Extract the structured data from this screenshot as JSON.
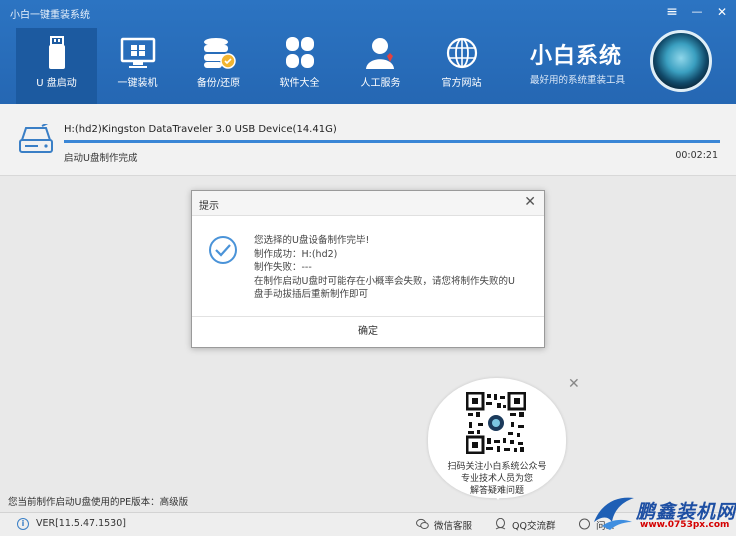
{
  "app": {
    "title": "小白一键重装系统"
  },
  "window_controls": {
    "menu": "≡",
    "minimize": "—",
    "close": "✕"
  },
  "nav": {
    "items": [
      {
        "label": "U 盘启动",
        "icon": "usb-drive-icon",
        "active": true
      },
      {
        "label": "一键装机",
        "icon": "monitor-icon",
        "active": false
      },
      {
        "label": "备份/还原",
        "icon": "database-backup-icon",
        "active": false
      },
      {
        "label": "软件大全",
        "icon": "clover-apps-icon",
        "active": false
      },
      {
        "label": "人工服务",
        "icon": "support-person-icon",
        "active": false
      },
      {
        "label": "官方网站",
        "icon": "globe-icon",
        "active": false
      }
    ]
  },
  "brand": {
    "name": "小白系统",
    "slogan": "最好用的系统重装工具"
  },
  "device": {
    "name": "H:(hd2)Kingston DataTraveler 3.0 USB Device(14.41G)",
    "status": "启动U盘制作完成",
    "elapsed": "00:02:21",
    "progress": 1.0
  },
  "dialog": {
    "title": "提示",
    "close": "✕",
    "lines": [
      "您选择的U盘设备制作完毕!",
      "制作成功：H:(hd2)",
      "制作失败：---",
      "在制作启动U盘时可能存在小概率会失败，请您将制作失败的U",
      "盘手动拔插后重新制作即可"
    ],
    "ok": "确定"
  },
  "qr_popup": {
    "close": "✕",
    "lines": [
      "扫码关注小白系统公众号",
      "专业技术人员为您",
      "解答疑难问题"
    ]
  },
  "footer": {
    "pe_info": "您当前制作启动U盘使用的PE版本：高级版",
    "version": "VER[11.5.47.1530]",
    "wechat": "微信客服",
    "qq": "QQ交流群",
    "help": "问..."
  },
  "watermark": {
    "name": "鹏鑫装机网",
    "url": "www.0753px.com"
  },
  "colors": {
    "header": "#2567b3",
    "active_nav": "#1c5aa0",
    "accent": "#3a86d6"
  }
}
